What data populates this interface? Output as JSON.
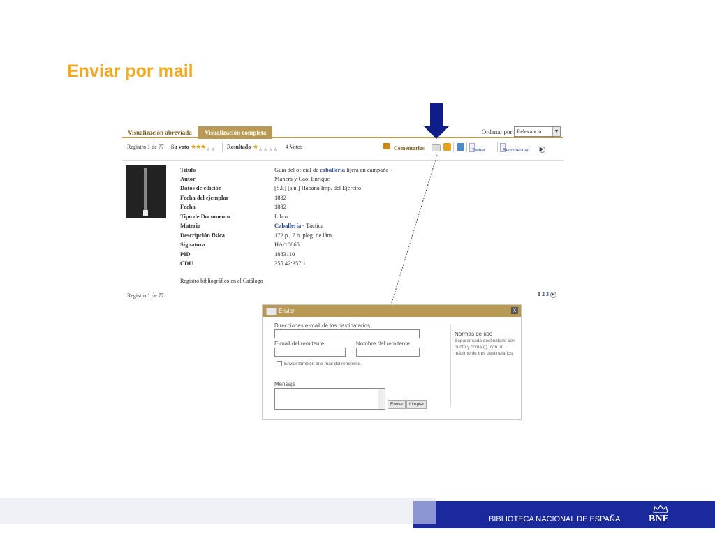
{
  "slide": {
    "title": "Enviar por mail"
  },
  "tabs": {
    "abreviada": "Visualización abreviada",
    "completa": "Visualización completa"
  },
  "order": {
    "label": "Ordenar por:",
    "selected": "Relevancia"
  },
  "toolbar": {
    "registro": "Registro 1 de 77",
    "su_voto": "Su voto",
    "resultado": "Resultado",
    "votos": "4 Votos",
    "comentarios": "Comentarios",
    "twitter": "Twitter",
    "recomendar": "Recomendar",
    "pages": [
      "1",
      "2",
      "3"
    ]
  },
  "record": {
    "fields": [
      {
        "label": "Título",
        "value": "Guía del oficial de ",
        "link": "caballería",
        "rest": " lijera en campaña -"
      },
      {
        "label": "Autor",
        "value": "Manera y Cao, Enrique"
      },
      {
        "label": "Datos de edición",
        "value": "[S.l.] [s.n.] Habana Imp. del Ejército"
      },
      {
        "label": "Fecha del ejemplar",
        "value": "1882"
      },
      {
        "label": "Fecha",
        "value": "1882"
      },
      {
        "label": "Tipo de Documento",
        "value": "Libro"
      },
      {
        "label": "Materia",
        "value": "",
        "link": "Caballería",
        "rest": " - Táctica"
      },
      {
        "label": "Descripción física",
        "value": "172 p., 7 h. pleg. de lám."
      },
      {
        "label": "Signatura",
        "value": "HA/10065"
      },
      {
        "label": "PID",
        "value": "1883110"
      },
      {
        "label": "CDU",
        "value": "355.42:357.1"
      }
    ],
    "catalog_link": "Registro bibliográfico en el Catálogo",
    "registro_bottom": "Registro 1 de 77"
  },
  "dialog": {
    "title": "Enviar",
    "close": "x",
    "dest_label": "Direcciones e-mail de los destinatarios",
    "email_label": "E-mail del remitente",
    "name_label": "Nombre del remitente",
    "copy_label": "Enviar también al e-mail del remitente.",
    "message_label": "Mensaje",
    "send_button": "Enviar",
    "clear_button": "Limpiar",
    "norms_title": "Normas de uso",
    "norms_text": "Separar cada destinatario con punto y coma (;), con un máximo de tres destinatarios."
  },
  "footer": {
    "text": "BIBLIOTECA NACIONAL DE ESPAÑA",
    "logo": "BNE"
  },
  "colors": {
    "title": "#f2a91e",
    "tab": "#b99a55",
    "footer_blue": "#1a2a9d",
    "arrow": "#0f1d8a"
  }
}
